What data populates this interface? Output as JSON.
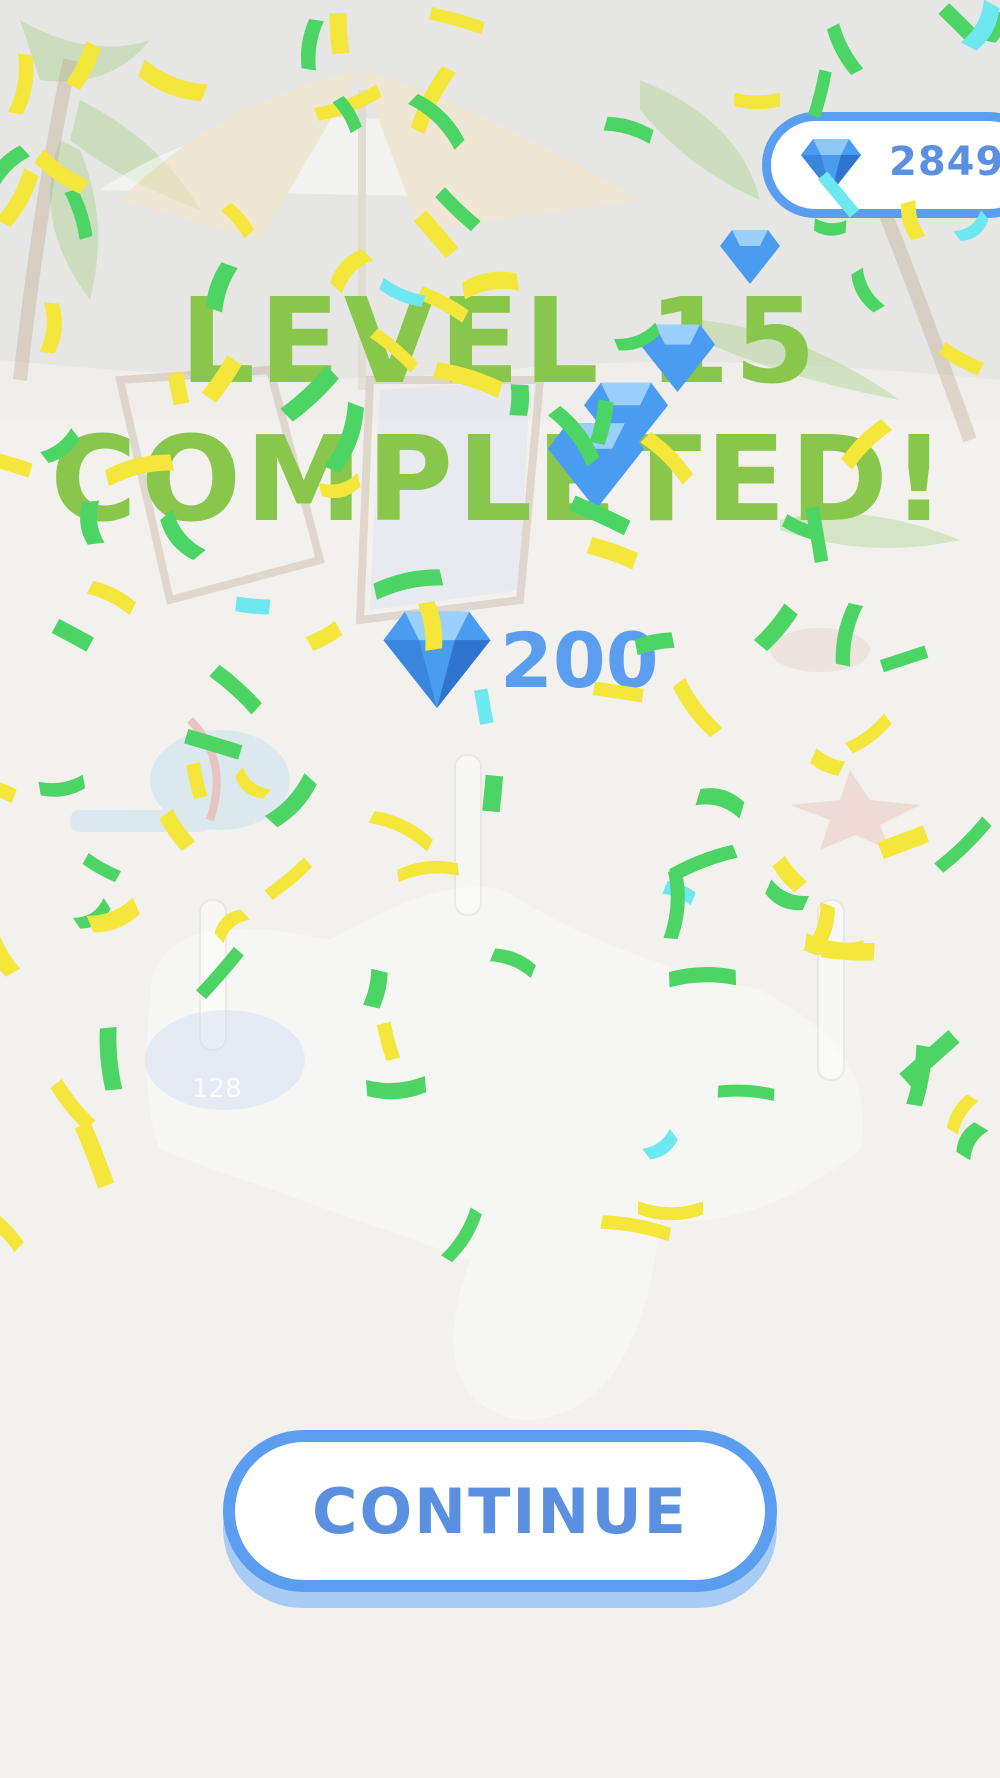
{
  "hud": {
    "gem_icon": "diamond-icon",
    "gem_count": "2849"
  },
  "title": {
    "line1": "LEVEL 15",
    "line2": "COMPLETED!"
  },
  "reward": {
    "gem_icon": "diamond-icon",
    "amount": "200"
  },
  "scene": {
    "ring_label": "128"
  },
  "continue_button": {
    "label": "CONTINUE"
  },
  "colors": {
    "accent_blue": "#5b9ef0",
    "title_green": "#88c64c",
    "confetti_green": "#4cd464",
    "confetti_yellow": "#f4e63a",
    "confetti_cyan": "#6ee8f0"
  }
}
